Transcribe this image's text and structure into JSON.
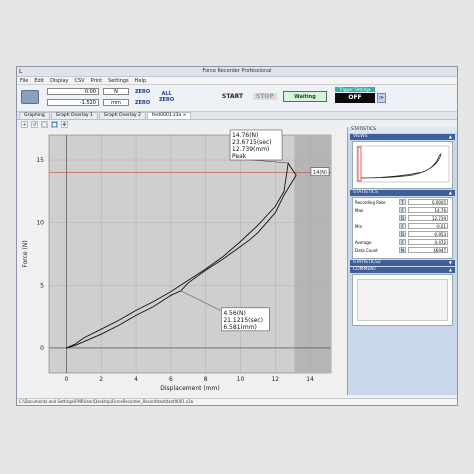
{
  "window": {
    "title": "Force Recorder Professional",
    "app_icon_glyph": "L"
  },
  "menu": [
    "File",
    "Edit",
    "Display",
    "CSV",
    "Print",
    "Settings",
    "Help"
  ],
  "toolbar": {
    "force_value": "0.00",
    "force_unit": "N",
    "disp_value": "-1.520",
    "disp_unit": "mm",
    "zero_label": "ZERO",
    "all_zero_line1": "ALL",
    "all_zero_line2": "ZERO",
    "start_label": "START",
    "stop_label": "STOP",
    "waiting_label": "Waiting",
    "trigger_label": "Trigger Settings",
    "trigger_value": "OFF",
    "trigger_btn": "≫"
  },
  "tabs": [
    "Graphing",
    "Graph Overlay 1",
    "Graph Overlay 2",
    "fest0001.z3a ×"
  ],
  "graph_tools": [
    "icon-a",
    "icon-b",
    "icon-c",
    "icon-d",
    "icon-e"
  ],
  "chart_data": {
    "type": "line",
    "xlabel": "Displacement (mm)",
    "ylabel": "Force (N)",
    "xlim": [
      -1,
      15.2
    ],
    "ylim": [
      -2,
      17
    ],
    "xticks": [
      0,
      2,
      4,
      6,
      8,
      10,
      12,
      14
    ],
    "yticks": [
      0,
      5,
      10,
      15
    ],
    "threshold": {
      "value": 14,
      "label": "14(N)"
    },
    "series": [
      {
        "x": [
          0,
          0.5,
          1,
          2,
          3,
          4,
          5,
          6,
          7,
          8,
          9,
          10,
          11,
          12,
          12.5,
          12.74,
          12.9,
          13.2
        ],
        "y": [
          0,
          0.3,
          0.8,
          1.5,
          2.2,
          3,
          3.7,
          4.5,
          5.4,
          6.3,
          7.3,
          8.5,
          9.8,
          11.3,
          12.5,
          14.76,
          14.4,
          13.8
        ]
      },
      {
        "x": [
          13.2,
          12.5,
          12,
          11.5,
          11,
          10.5,
          10,
          9,
          8,
          7,
          6.58,
          6,
          5,
          4,
          3,
          2,
          1,
          0.5,
          0
        ],
        "y": [
          13.8,
          12.2,
          10.8,
          10,
          9.2,
          8.6,
          8.1,
          7.1,
          6.2,
          5.2,
          4.56,
          4.2,
          3.3,
          2.6,
          1.8,
          1.1,
          0.5,
          0.2,
          0
        ]
      }
    ],
    "annotations": [
      {
        "lines": [
          "14.76(N)",
          "23.6715(sec)",
          "12.739(mm)",
          "Peak"
        ]
      },
      {
        "lines": [
          "4.56(N)",
          "21.1215(sec)",
          "6.581(mm)"
        ]
      }
    ]
  },
  "sidebar": {
    "header": "STATISTICS",
    "views_label": "VIEWS",
    "stats_label": "STATISTICS",
    "stats2_label": "STATISTICS2",
    "comment_label": "COMMENT",
    "stats": [
      {
        "label": "Recording Rate",
        "chip": "T",
        "value": "0.0005"
      },
      {
        "label": "Max",
        "chip": "F",
        "value": "14.76"
      },
      {
        "label": "",
        "chip": "D",
        "value": "12.739"
      },
      {
        "label": "Min",
        "chip": "F",
        "value": "-0.01"
      },
      {
        "label": "",
        "chip": "D",
        "value": "-0.953"
      },
      {
        "label": "Average",
        "chip": "F",
        "value": "4.472"
      },
      {
        "label": "Data Count",
        "chip": "N",
        "value": "46947"
      }
    ]
  },
  "status": "C:\\Documents and Settings\\FMRUser\\Desktop\\ForceRecorder_Record\\test\\test0001.z3a"
}
